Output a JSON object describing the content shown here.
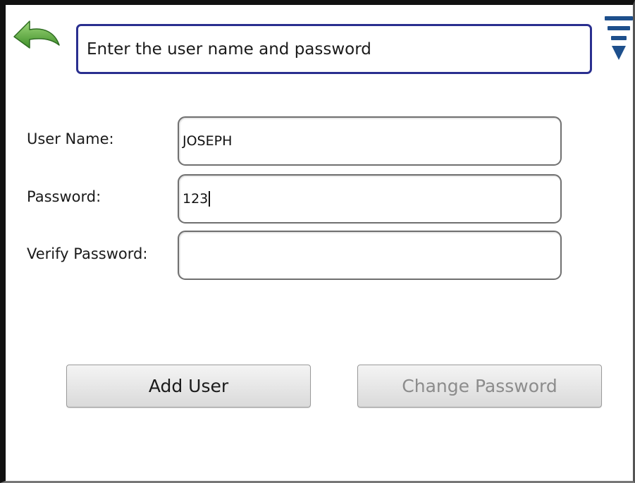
{
  "header": {
    "back_icon": "curved-back-arrow-icon",
    "prompt_text": "Enter the user name and password",
    "menu_icon": "dropdown-menu-icon",
    "accent_color": "#2a2f8f",
    "icon_green": "#5aa63a",
    "icon_blue": "#1d4f8c"
  },
  "form": {
    "username": {
      "label": "User Name:",
      "value": "JOSEPH"
    },
    "password": {
      "label": "Password:",
      "value": "123"
    },
    "verify_password": {
      "label": "Verify Password:",
      "value": ""
    }
  },
  "buttons": {
    "add_user": "Add User",
    "change_password": "Change Password"
  }
}
